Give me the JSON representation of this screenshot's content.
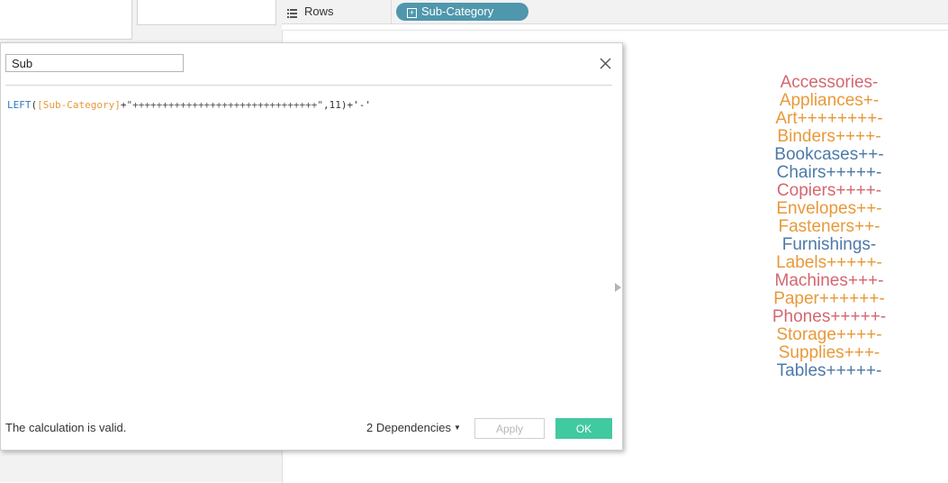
{
  "shelf": {
    "rows_label": "Rows",
    "pill_label": "Sub-Category",
    "pill_icon": "plus-box-icon"
  },
  "dialog": {
    "name_value": "Sub",
    "formula": {
      "func": "LEFT",
      "open_paren": "(",
      "field": "[Sub-Category]",
      "plus1": "+",
      "string": "\"+++++++++++++++++++++++++++++++\"",
      "rest": ",11)+'-'"
    },
    "status": "The calculation is valid.",
    "dependencies_label": "2 Dependencies",
    "apply_label": "Apply",
    "ok_label": "OK"
  },
  "colors": {
    "pill": "#4f97ad",
    "ok": "#41c9a0",
    "red": "#d4676f",
    "orange": "#e8993a",
    "blue": "#4e79a7"
  },
  "categories": [
    {
      "label": "Accessories-",
      "color": "#d4676f"
    },
    {
      "label": "Appliances+-",
      "color": "#e8993a"
    },
    {
      "label": "Art++++++++-",
      "color": "#e8993a"
    },
    {
      "label": "Binders++++-",
      "color": "#e8993a"
    },
    {
      "label": "Bookcases++-",
      "color": "#4e79a7"
    },
    {
      "label": "Chairs+++++-",
      "color": "#4e79a7"
    },
    {
      "label": "Copiers++++-",
      "color": "#d4676f"
    },
    {
      "label": "Envelopes++-",
      "color": "#e8993a"
    },
    {
      "label": "Fasteners++-",
      "color": "#e8993a"
    },
    {
      "label": "Furnishings-",
      "color": "#4e79a7"
    },
    {
      "label": "Labels+++++-",
      "color": "#e8993a"
    },
    {
      "label": "Machines+++-",
      "color": "#d4676f"
    },
    {
      "label": "Paper++++++-",
      "color": "#e8993a"
    },
    {
      "label": "Phones+++++-",
      "color": "#d4676f"
    },
    {
      "label": "Storage++++-",
      "color": "#e8993a"
    },
    {
      "label": "Supplies+++-",
      "color": "#e8993a"
    },
    {
      "label": "Tables+++++-",
      "color": "#4e79a7"
    }
  ]
}
